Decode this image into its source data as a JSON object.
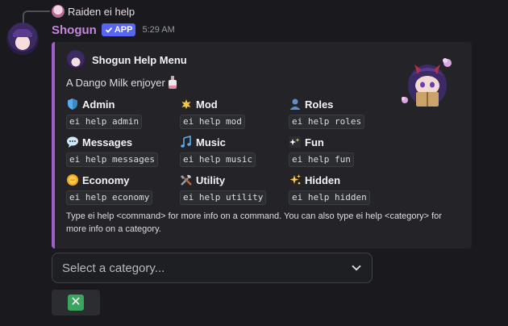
{
  "reply": {
    "text": "Raiden ei help"
  },
  "message": {
    "username": "Shogun",
    "badge": "APP",
    "timestamp": "5:29 AM"
  },
  "embed": {
    "author": "Shogun Help Menu",
    "description": "A Dango Milk enjoyer",
    "accent_color": "#a05ec9",
    "fields": [
      {
        "title": "Admin",
        "code": "ei help admin",
        "icon": "shield-icon"
      },
      {
        "title": "Mod",
        "code": "ei help mod",
        "icon": "mod-icon"
      },
      {
        "title": "Roles",
        "code": "ei help roles",
        "icon": "user-icon"
      },
      {
        "title": "Messages",
        "code": "ei help messages",
        "icon": "speech-balloon-icon"
      },
      {
        "title": "Music",
        "code": "ei help music",
        "icon": "music-notes-icon"
      },
      {
        "title": "Fun",
        "code": "ei help fun",
        "icon": "sparkles-icon"
      },
      {
        "title": "Economy",
        "code": "ei help economy",
        "icon": "coin-icon"
      },
      {
        "title": "Utility",
        "code": "ei help utility",
        "icon": "tools-icon"
      },
      {
        "title": "Hidden",
        "code": "ei help hidden",
        "icon": "sparkle-icon"
      }
    ],
    "footer": "Type ei help <command> for more info on a command. You can also type ei help <category> for more info on a category."
  },
  "select": {
    "placeholder": "Select a category..."
  },
  "cancel_button": {
    "icon": "cross-mark-icon"
  }
}
